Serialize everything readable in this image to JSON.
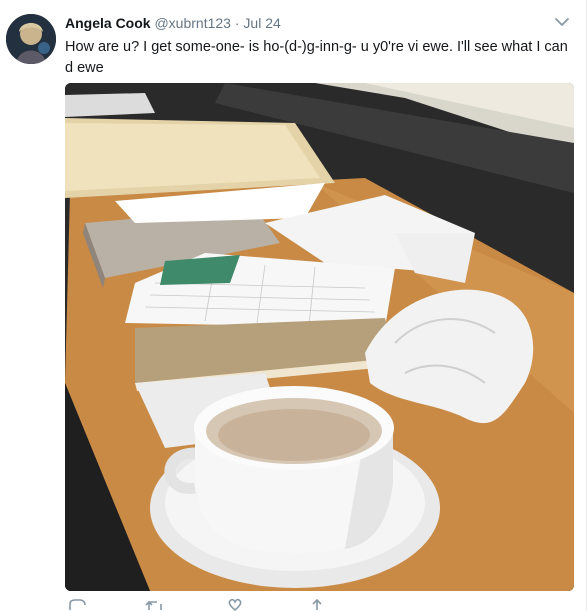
{
  "tweet": {
    "author_name": "Angela Cook",
    "handle": "@xubrnt123",
    "separator": "·",
    "date": "Jul 24",
    "text": "How are u? I get some-one- is ho-(d-)g-inn-g- u y0'​re vi ewe. I'll see what I can d ewe"
  },
  "icons": {
    "caret": "chevron-down-icon",
    "reply": "reply-icon",
    "retweet": "retweet-icon",
    "like": "heart-icon",
    "share": "share-icon"
  },
  "colors": {
    "text": "#14171a",
    "secondary": "#657786",
    "icon": "#8899a6"
  }
}
